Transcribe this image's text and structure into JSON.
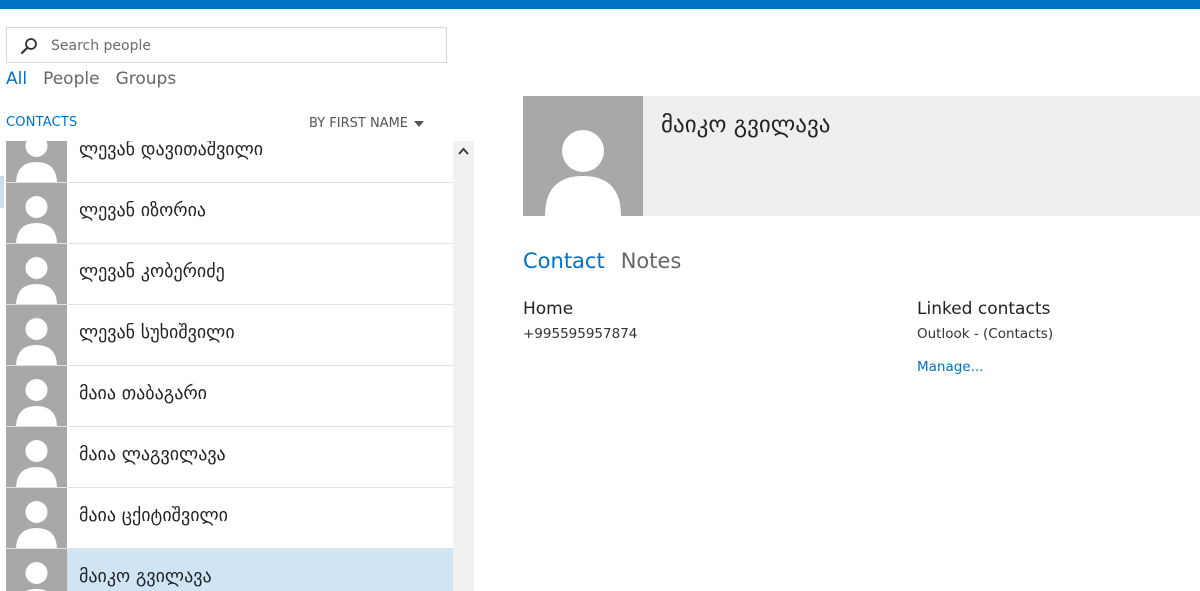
{
  "search": {
    "placeholder": "Search people"
  },
  "filters": [
    "All",
    "People",
    "Groups"
  ],
  "list_header": {
    "label": "CONTACTS",
    "sort": "BY FIRST NAME"
  },
  "contacts": [
    {
      "name": "ლევან დავითაშვილი",
      "selected": false
    },
    {
      "name": "ლევან იზორია",
      "selected": false
    },
    {
      "name": "ლევან კობერიძე",
      "selected": false
    },
    {
      "name": "ლევან სუხიშვილი",
      "selected": false
    },
    {
      "name": "მაია თაბაგარი",
      "selected": false
    },
    {
      "name": "მაია ლაგვილავა",
      "selected": false
    },
    {
      "name": "მაია ცქიტიშვილი",
      "selected": false
    },
    {
      "name": "მაიკო გვილავა",
      "selected": true
    }
  ],
  "detail": {
    "name": "მაიკო გვილავა",
    "tabs": [
      "Contact",
      "Notes"
    ],
    "home_label": "Home",
    "home_phone": "+995595957874",
    "linked_label": "Linked contacts",
    "linked_source": "Outlook - (Contacts)",
    "manage_link": "Manage..."
  },
  "colors": {
    "accent": "#0072c6",
    "selected_row": "#cfe5f6",
    "avatar_bg": "#a8a8a8",
    "header_bg": "#efefef"
  }
}
